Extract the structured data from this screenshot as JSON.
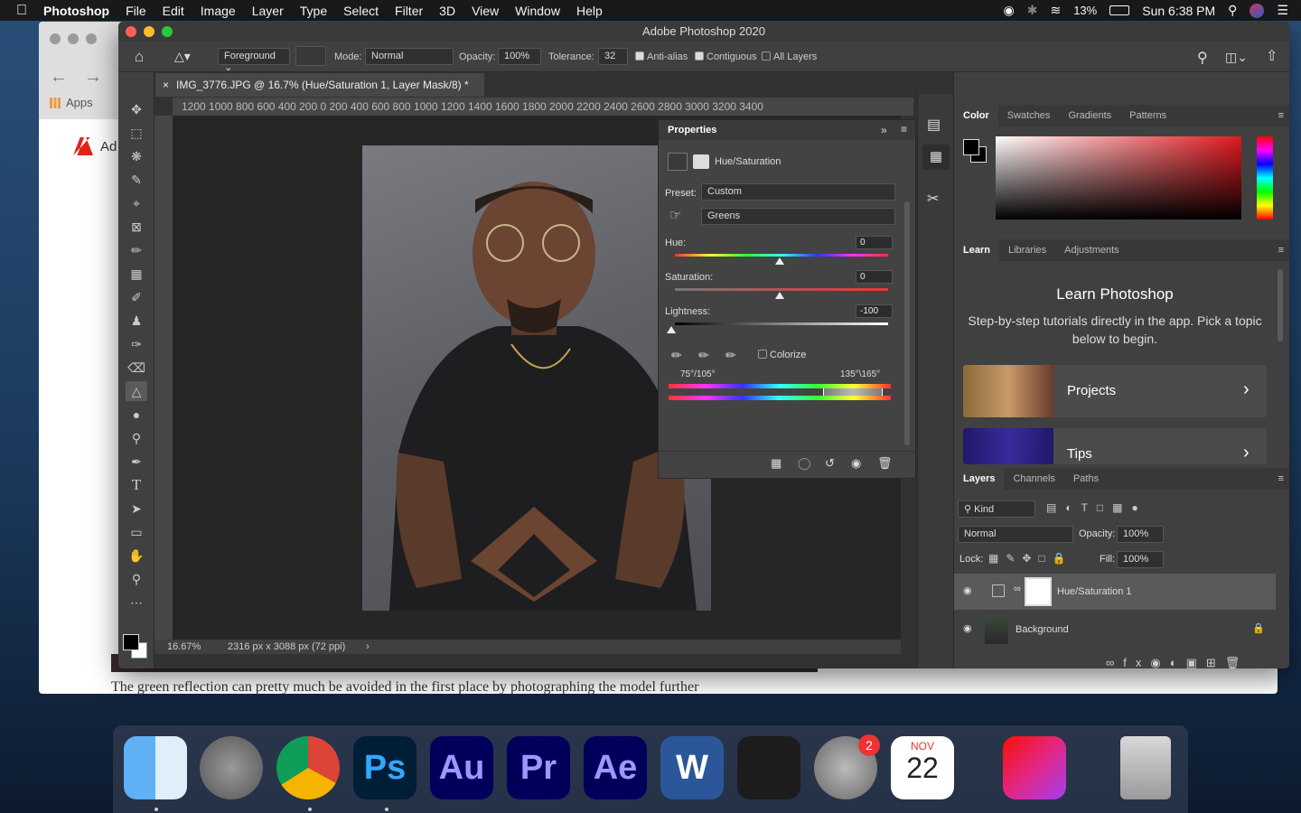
{
  "menubar": {
    "apple": "",
    "items": [
      "Photoshop",
      "File",
      "Edit",
      "Image",
      "Layer",
      "Type",
      "Select",
      "Filter",
      "3D",
      "View",
      "Window",
      "Help"
    ],
    "battery": "13%",
    "clock": "Sun 6:38 PM"
  },
  "browser": {
    "apps_label": "Apps",
    "brand_text": "Ad",
    "footer_text": "The green reflection can pretty much be avoided in the first place by photographing the model further"
  },
  "window": {
    "title": "Adobe Photoshop 2020"
  },
  "options": {
    "fill_source": "Foreground",
    "mode_label": "Mode:",
    "mode_value": "Normal",
    "opacity_label": "Opacity:",
    "opacity_value": "100%",
    "tolerance_label": "Tolerance:",
    "tolerance_value": "32",
    "antialias": "Anti-alias",
    "contiguous": "Contiguous",
    "all_layers": "All Layers"
  },
  "document": {
    "tab_title": "IMG_3776.JPG @ 16.7% (Hue/Saturation 1, Layer Mask/8) *",
    "ruler_ticks": "1200  1000   800   600   400   200   0      200   400   600   800   1000  1200  1400  1600  1800  2000  2200  2400  2600  2800  3000  3200  3400",
    "zoom": "16.67%",
    "dimensions": "2316 px x 3088 px (72 ppi)"
  },
  "properties": {
    "title": "Properties",
    "adjustment": "Hue/Saturation",
    "preset_label": "Preset:",
    "preset_value": "Custom",
    "range_value": "Greens",
    "hue_label": "Hue:",
    "hue_value": "0",
    "saturation_label": "Saturation:",
    "saturation_value": "0",
    "lightness_label": "Lightness:",
    "lightness_value": "-100",
    "colorize_label": "Colorize",
    "range_left": "75°/105°",
    "range_right": "135°\\165°"
  },
  "color_panel": {
    "tabs": [
      "Color",
      "Swatches",
      "Gradients",
      "Patterns"
    ]
  },
  "learn_panel": {
    "tabs": [
      "Learn",
      "Libraries",
      "Adjustments"
    ],
    "heading": "Learn Photoshop",
    "description": "Step-by-step tutorials directly in the app. Pick a topic below to begin.",
    "cards": [
      "Projects",
      "Tips"
    ]
  },
  "layers_panel": {
    "tabs": [
      "Layers",
      "Channels",
      "Paths"
    ],
    "kind": "Kind",
    "blend_mode": "Normal",
    "opacity_label": "Opacity:",
    "opacity_value": "100%",
    "lock_label": "Lock:",
    "fill_label": "Fill:",
    "fill_value": "100%",
    "layers": [
      "Hue/Saturation 1",
      "Background"
    ]
  },
  "dock": {
    "apps": [
      {
        "name": "Finder",
        "label": "",
        "bg": "#3d8be8"
      },
      {
        "name": "Launchpad",
        "label": "",
        "bg": "#6a6f78"
      },
      {
        "name": "Chrome",
        "label": "",
        "bg": "#ffffff"
      },
      {
        "name": "Photoshop",
        "label": "Ps",
        "bg": "#001e36"
      },
      {
        "name": "Audition",
        "label": "Au",
        "bg": "#00005b"
      },
      {
        "name": "Premiere",
        "label": "Pr",
        "bg": "#00005b"
      },
      {
        "name": "After Effects",
        "label": "Ae",
        "bg": "#00005b"
      },
      {
        "name": "Word",
        "label": "W",
        "bg": "#2b579a"
      },
      {
        "name": "Voice Memos",
        "label": "",
        "bg": "#1c1c1c"
      },
      {
        "name": "System Preferences",
        "label": "",
        "bg": "#8a8a8a"
      },
      {
        "name": "Calendar",
        "label": "22",
        "bg": "#ffffff"
      },
      {
        "name": "Creative Cloud",
        "label": "",
        "bg": "#e8335a"
      },
      {
        "name": "Trash",
        "label": "",
        "bg": "transparent"
      }
    ],
    "calendar_month": "NOV",
    "calendar_day": "22",
    "sysprefs_badge": "2"
  }
}
